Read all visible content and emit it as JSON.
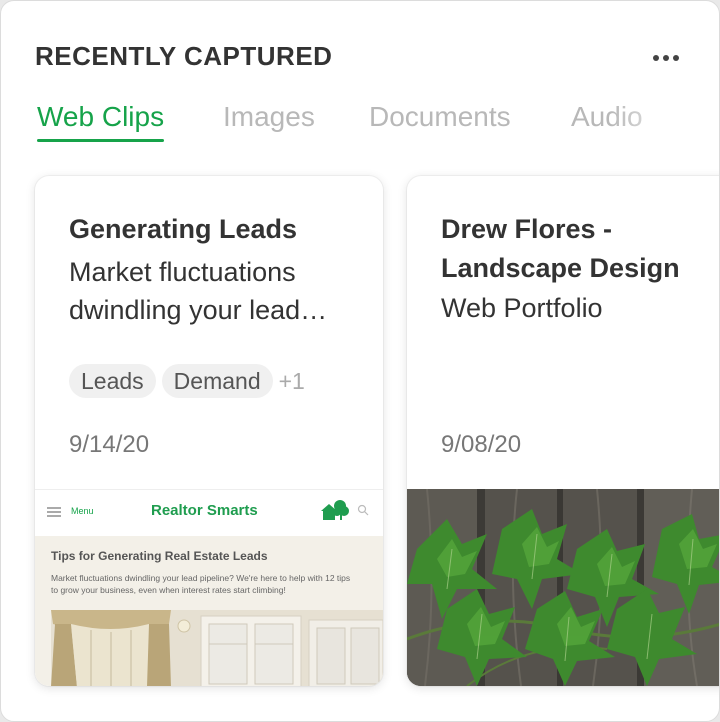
{
  "widget": {
    "title": "RECENTLY CAPTURED",
    "more_icon": "ellipsis-horizontal-icon"
  },
  "tabs": [
    {
      "label": "Web Clips",
      "active": true
    },
    {
      "label": "Images",
      "active": false
    },
    {
      "label": "Documents",
      "active": false
    },
    {
      "label": "Audio",
      "active": false
    }
  ],
  "cards": [
    {
      "title": "Generating Leads",
      "subtitle": "Market fluctuations dwindling your lead…",
      "tags": [
        "Leads",
        "Demand"
      ],
      "more_tags": "+1",
      "date": "9/14/20",
      "preview": {
        "menu_label": "Menu",
        "brand": "Realtor Smarts",
        "headline": "Tips for Generating Real Estate Leads",
        "text": "Market fluctuations dwindling your lead pipeline? We're here to help with 12 tips to grow your business, even when interest rates start climbing!"
      }
    },
    {
      "title": "Drew Flores - Landscape Design",
      "subtitle": "Web Portfolio",
      "date": "9/08/20",
      "preview_image": "ivy-leaves-on-wood-photo"
    }
  ],
  "colors": {
    "accent": "#16a34a",
    "brand_green": "#1f9d4f",
    "inactive_tab": "#b8b8b8"
  }
}
